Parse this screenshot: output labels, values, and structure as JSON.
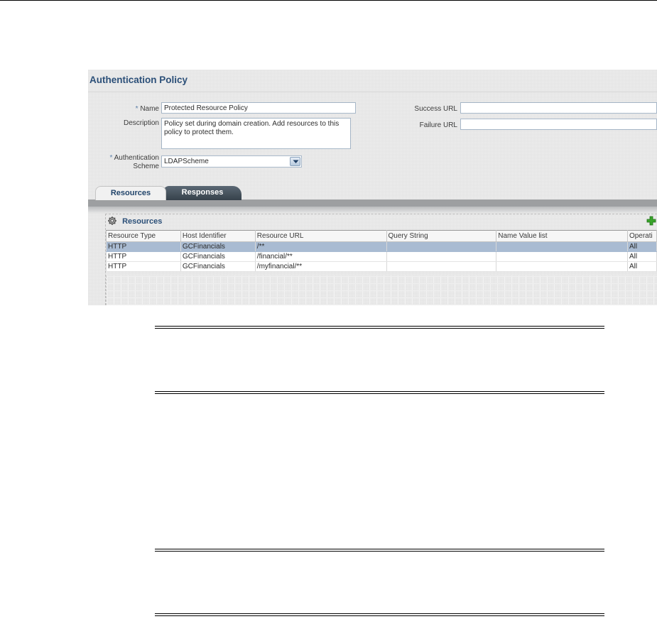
{
  "panel": {
    "title": "Authentication Policy"
  },
  "form": {
    "name_required_mark": "*",
    "name_label": "Name",
    "name_value": "Protected Resource Policy",
    "description_label": "Description",
    "description_value": "Policy set during domain creation. Add resources to this policy to protect them.",
    "auth_scheme_required_mark": "*",
    "auth_scheme_label_line1": "Authentication",
    "auth_scheme_label_line2": "Scheme",
    "auth_scheme_value": "LDAPScheme",
    "success_url_label": "Success URL",
    "success_url_value": "",
    "failure_url_label": "Failure URL",
    "failure_url_value": ""
  },
  "tabs": [
    {
      "label": "Resources",
      "active": true
    },
    {
      "label": "Responses",
      "active": false
    }
  ],
  "resources": {
    "title": "Resources",
    "columns": [
      "Resource Type",
      "Host Identifier",
      "Resource URL",
      "Query String",
      "Name Value list",
      "Operati"
    ],
    "rows": [
      {
        "type": "HTTP",
        "host": "GCFinancials",
        "url": "/**",
        "query": "",
        "nvlist": "",
        "ops": "All",
        "selected": true
      },
      {
        "type": "HTTP",
        "host": "GCFinancials",
        "url": "/financial/**",
        "query": "",
        "nvlist": "",
        "ops": "All",
        "selected": false
      },
      {
        "type": "HTTP",
        "host": "GCFinancials",
        "url": "/myfinancial/**",
        "query": "",
        "nvlist": "",
        "ops": "All",
        "selected": false
      }
    ]
  },
  "colors": {
    "title_blue": "#2b4f78",
    "selected_row": "#a9bbd2",
    "add_icon_green": "#3aa52b"
  },
  "icons": [
    "gear-icon",
    "add-icon",
    "chevron-down-icon"
  ]
}
